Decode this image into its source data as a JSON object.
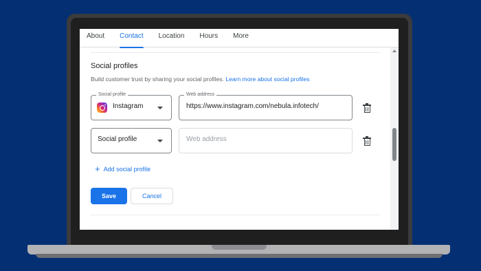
{
  "tabs": [
    "About",
    "Contact",
    "Location",
    "Hours",
    "More"
  ],
  "active_tab": "Contact",
  "section": {
    "title": "Social profiles",
    "description": "Build customer trust by sharing your social profiles.",
    "learn_more": "Learn more about social profiles"
  },
  "profiles": [
    {
      "profile_label": "Social profile",
      "profile_value": "Instagram",
      "profile_icon": "instagram-icon",
      "address_label": "Web address",
      "address_value": "https://www.instagram.com/nebula.infotech/"
    },
    {
      "profile_value": "Social profile",
      "address_placeholder": "Web address"
    }
  ],
  "add_profile": "Add social profile",
  "buttons": {
    "save": "Save",
    "cancel": "Cancel"
  },
  "colors": {
    "accent": "#1a73e8",
    "background": "#042f73"
  }
}
